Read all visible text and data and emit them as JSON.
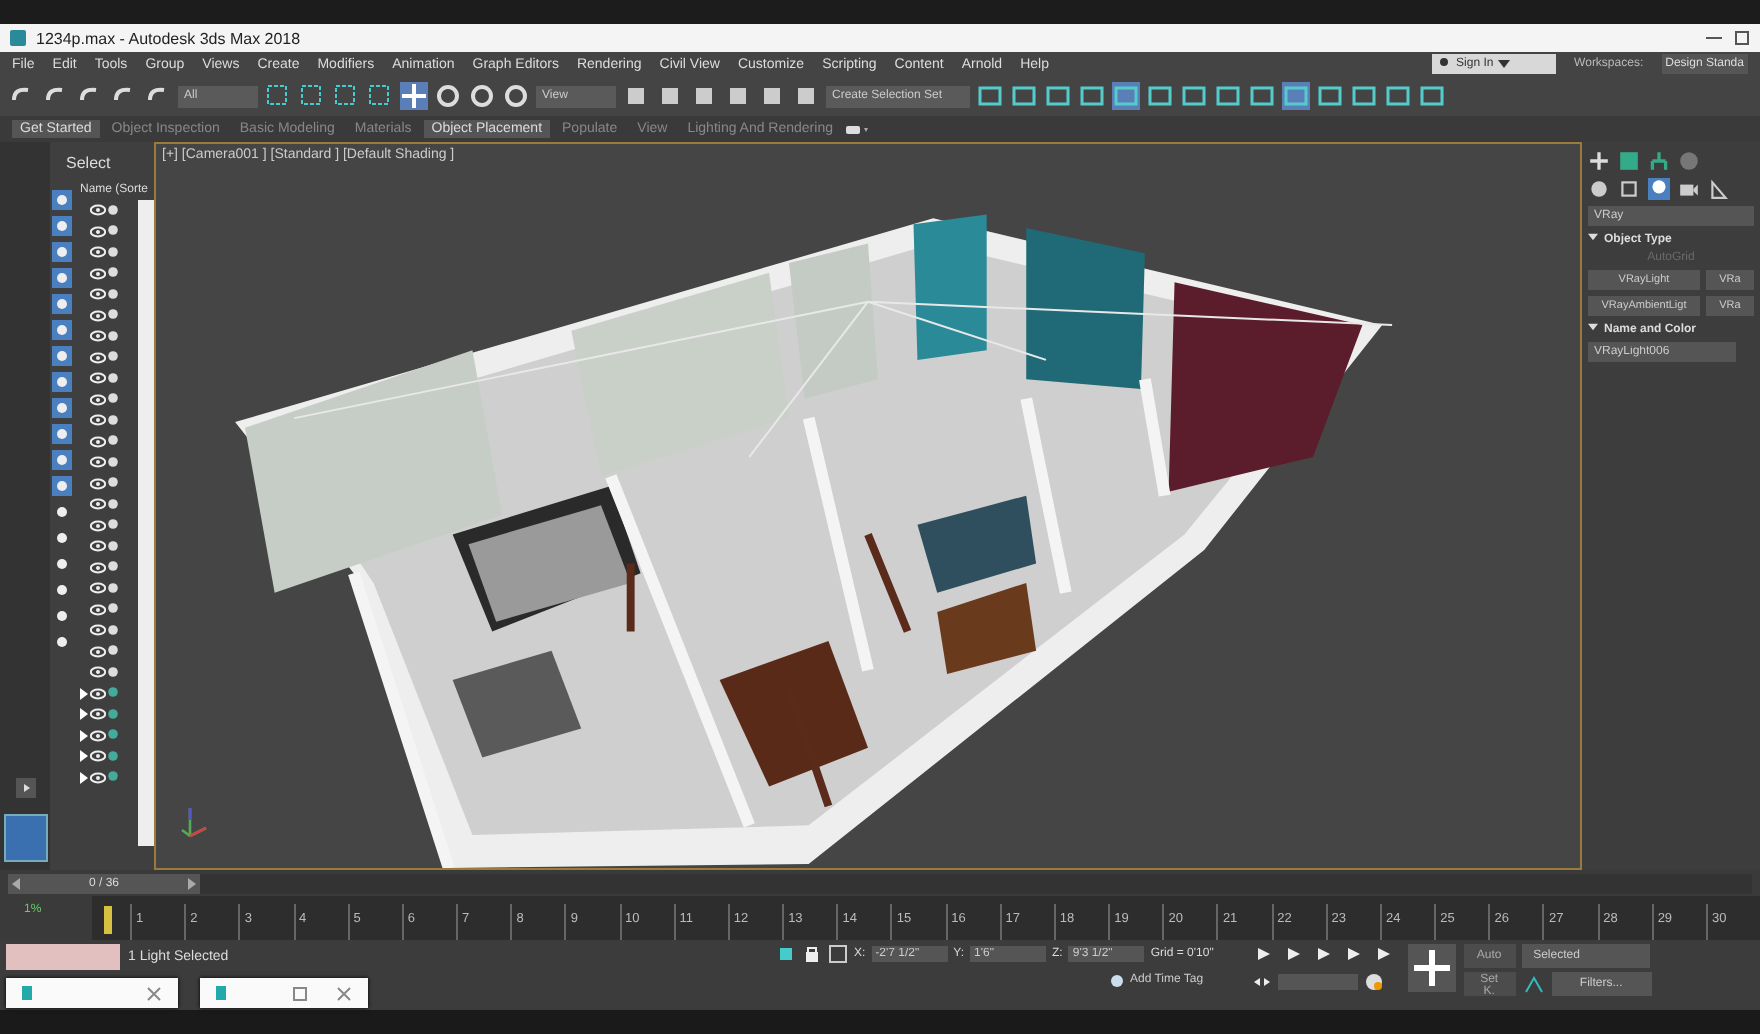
{
  "window": {
    "title": "1234p.max - Autodesk 3ds Max 2018"
  },
  "menu": [
    "File",
    "Edit",
    "Tools",
    "Group",
    "Views",
    "Create",
    "Modifiers",
    "Animation",
    "Graph Editors",
    "Rendering",
    "Civil View",
    "Customize",
    "Scripting",
    "Content",
    "Arnold",
    "Help"
  ],
  "account": {
    "sign_in": "Sign In",
    "workspaces_label": "Workspaces:",
    "workspace": "Design Standa"
  },
  "toolbar": {
    "selection_filter": "All",
    "reference_coord": "View",
    "selection_set": "Create Selection Set"
  },
  "ribbon_tabs": [
    {
      "label": "Get Started",
      "selected": true
    },
    {
      "label": "Object Inspection",
      "selected": false
    },
    {
      "label": "Basic Modeling",
      "selected": false
    },
    {
      "label": "Materials",
      "selected": false
    },
    {
      "label": "Object Placement",
      "selected": true
    },
    {
      "label": "Populate",
      "selected": false
    },
    {
      "label": "View",
      "selected": false
    },
    {
      "label": "Lighting And Rendering",
      "selected": false
    }
  ],
  "scene_explorer": {
    "title": "Select",
    "column": "Name (Sorte",
    "rows": [
      {
        "expandable": false
      },
      {
        "expandable": false
      },
      {
        "expandable": false
      },
      {
        "expandable": false
      },
      {
        "expandable": false
      },
      {
        "expandable": false
      },
      {
        "expandable": false
      },
      {
        "expandable": false
      },
      {
        "expandable": false
      },
      {
        "expandable": false
      },
      {
        "expandable": false
      },
      {
        "expandable": false
      },
      {
        "expandable": false
      },
      {
        "expandable": false
      },
      {
        "expandable": false
      },
      {
        "expandable": false
      },
      {
        "expandable": false
      },
      {
        "expandable": false
      },
      {
        "expandable": false
      },
      {
        "expandable": false
      },
      {
        "expandable": false
      },
      {
        "expandable": false
      },
      {
        "expandable": false
      },
      {
        "expandable": true
      },
      {
        "expandable": true
      },
      {
        "expandable": true
      },
      {
        "expandable": true
      },
      {
        "expandable": true
      }
    ]
  },
  "viewport": {
    "label": "[+] [Camera001 ] [Standard ] [Default Shading ]"
  },
  "command_panel": {
    "category": "VRay",
    "object_type": {
      "title": "Object Type",
      "autogrid": {
        "label": "AutoGrid",
        "disabled": true
      },
      "buttons": [
        "VRayLight",
        "VRa",
        "VRayAmbientLigt",
        "VRa"
      ]
    },
    "name_color": {
      "title": "Name and Color",
      "name": "VRayLight006"
    }
  },
  "time_slider": {
    "frame": "0 / 36",
    "level": 0
  },
  "trackbar": {
    "key_label": "1%",
    "ticks": [
      "1",
      "2",
      "3",
      "4",
      "5",
      "6",
      "7",
      "8",
      "9",
      "10",
      "11",
      "12",
      "13",
      "14",
      "15",
      "16",
      "17",
      "18",
      "19",
      "20",
      "21",
      "22",
      "23",
      "24",
      "25",
      "26",
      "27",
      "28",
      "29",
      "30"
    ]
  },
  "status": {
    "message": "1 Light Selected",
    "x_label": "X:",
    "x": "-2'7 1/2\"",
    "y_label": "Y:",
    "y": "1'6\"",
    "z_label": "Z:",
    "z": "9'3 1/2\"",
    "grid": "Grid = 0'10\"",
    "add_time_tag": "Add Time Tag",
    "auto": "Auto",
    "key_mode": "Selected",
    "set_key": "Set K.",
    "filters": "Filters..."
  }
}
